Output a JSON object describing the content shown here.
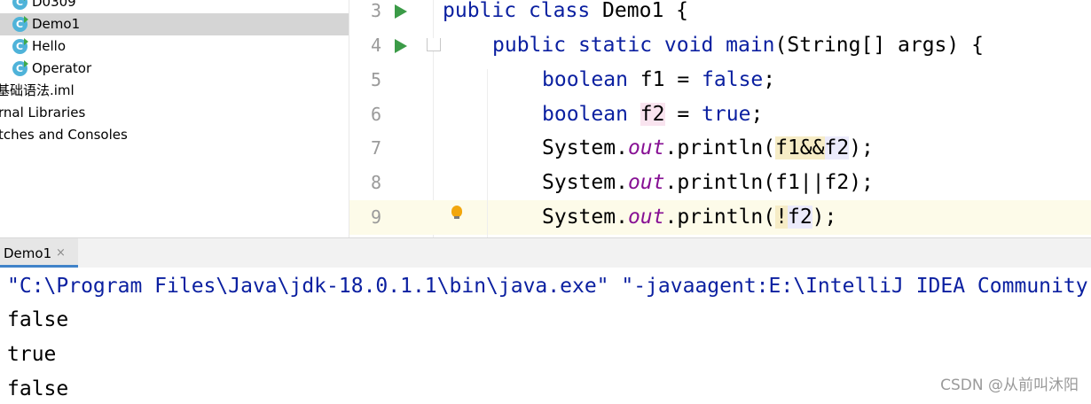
{
  "project_tree": {
    "items": [
      {
        "label": "D0309",
        "icon": "java-class-icon"
      },
      {
        "label": "Demo1",
        "icon": "java-class-icon",
        "selected": true
      },
      {
        "label": "Hello",
        "icon": "java-class-icon"
      },
      {
        "label": "Operator",
        "icon": "java-class-icon"
      },
      {
        "label": "基础语法.iml"
      },
      {
        "label": "rnal Libraries"
      },
      {
        "label": "tches and Consoles"
      }
    ]
  },
  "editor": {
    "line_numbers": [
      "3",
      "4",
      "5",
      "6",
      "7",
      "8",
      "9"
    ],
    "lines": [
      {
        "kw1": "public",
        "kw2": "class",
        "rest": " Demo1 {"
      },
      {
        "kw1": "public",
        "kw2": "static",
        "kw3": "void",
        "name": " main",
        "rest": "(String[] args) {"
      },
      {
        "kw": "boolean",
        "var": "f1",
        "eq": " = ",
        "val": "false",
        "end": ";"
      },
      {
        "kw": "boolean",
        "var": "f2",
        "eq": " = ",
        "val": "true",
        "end": ";"
      },
      {
        "obj": "System.",
        "field": "out",
        "call": ".println(",
        "a": "f1&&",
        "b": "f2",
        "end": ");"
      },
      {
        "obj": "System.",
        "field": "out",
        "call": ".println(",
        "arg": "f1||f2",
        "end": ");"
      },
      {
        "obj": "System.",
        "field": "out",
        "call": ".println(",
        "a": "!",
        "b": "f2",
        "end": ");"
      }
    ]
  },
  "run_window": {
    "tab_label": "Demo1",
    "close_glyph": "×",
    "console_lines": [
      "\"C:\\Program Files\\Java\\jdk-18.0.1.1\\bin\\java.exe\" \"-javaagent:E:\\IntelliJ IDEA Community",
      "false",
      "true",
      "false"
    ]
  },
  "watermark": "CSDN @从前叫沐阳",
  "colors": {
    "keyword": "#0a1fa0",
    "static_field": "#871094",
    "selection": "#d5d5d5",
    "run_icon": "#3b9b47",
    "tab_underline": "#4083c9"
  }
}
